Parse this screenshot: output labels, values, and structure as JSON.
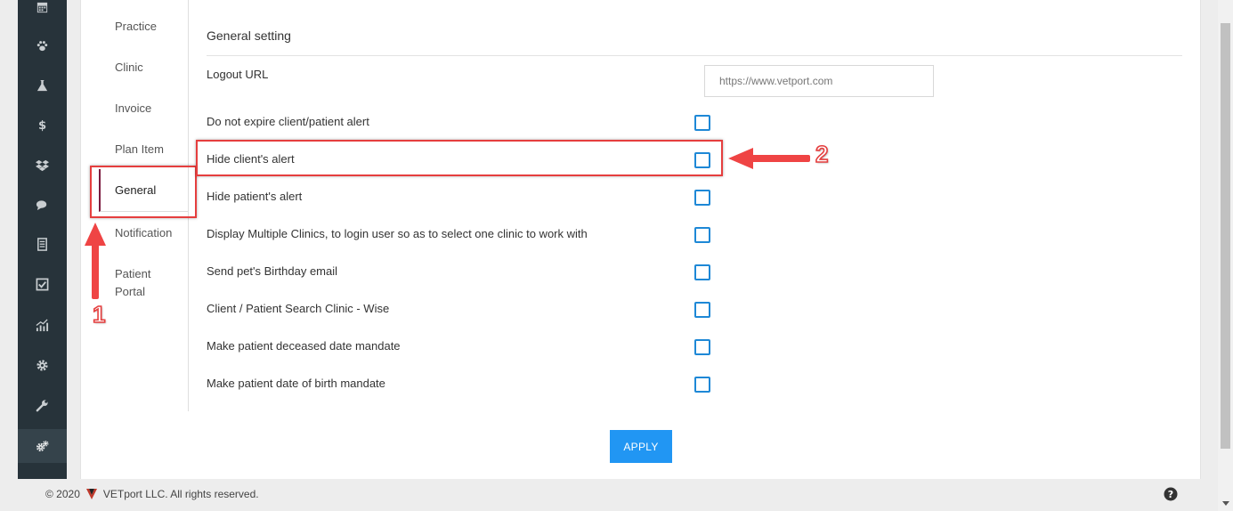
{
  "subnav": {
    "items": [
      {
        "label": "Practice"
      },
      {
        "label": "Clinic"
      },
      {
        "label": "Invoice"
      },
      {
        "label": "Plan Item"
      },
      {
        "label": "General"
      },
      {
        "label": "Notification"
      },
      {
        "label": "Patient Portal"
      }
    ],
    "active": "General"
  },
  "settings": {
    "title": "General setting",
    "logout_url": {
      "label": "Logout URL",
      "value": "",
      "placeholder": "https://www.vetport.com"
    },
    "options": [
      {
        "label": "Do not expire client/patient alert",
        "checked": false
      },
      {
        "label": "Hide client's alert",
        "checked": false
      },
      {
        "label": "Hide patient's alert",
        "checked": false
      },
      {
        "label": "Display Multiple Clinics, to login user so as to select one clinic to work with",
        "checked": false
      },
      {
        "label": "Send pet's Birthday email",
        "checked": false
      },
      {
        "label": "Client / Patient Search Clinic - Wise",
        "checked": false
      },
      {
        "label": "Make patient deceased date mandate",
        "checked": false
      },
      {
        "label": "Make patient date of birth mandate",
        "checked": false
      }
    ],
    "apply_label": "APPLY"
  },
  "annotations": {
    "step1": "1",
    "step2": "2"
  },
  "footer": {
    "copyright_year": "© 2020",
    "company_text": "VETport LLC. All rights reserved."
  },
  "sidebar_icons": [
    "calendar-icon",
    "paw-icon",
    "flask-icon",
    "dollar-icon",
    "dropbox-icon",
    "chat-icon",
    "document-icon",
    "checkbox-icon",
    "chart-icon",
    "gear-icon",
    "wrench-icon",
    "gears-icon"
  ],
  "colors": {
    "sidebar": "#27333a",
    "accent": "#2196f3",
    "checkbox_border": "#1e88d6",
    "annotation": "#e53e3e",
    "active_marker": "#7b1a3e"
  }
}
